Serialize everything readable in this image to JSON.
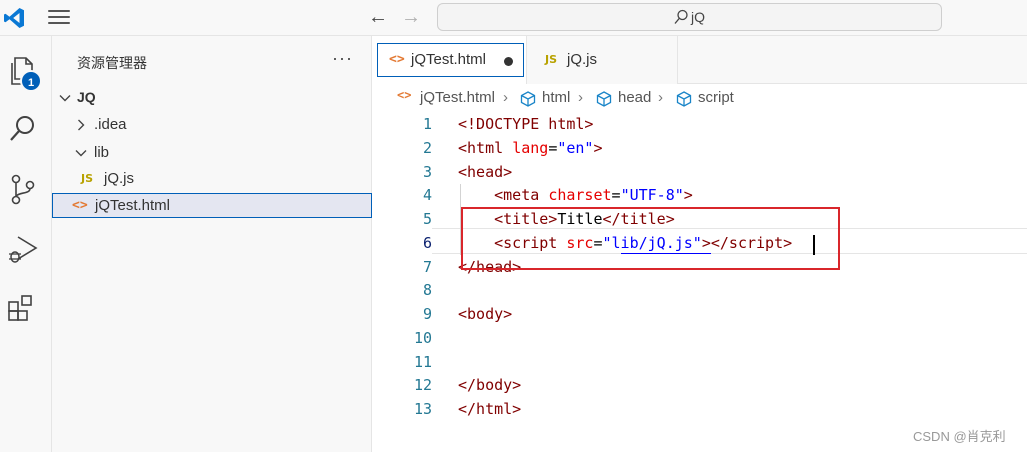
{
  "titlebar": {
    "search_text": "jQ",
    "icons": [
      "vscode-logo",
      "menu-icon",
      "arrow-left-icon",
      "arrow-right-icon",
      "search-icon"
    ]
  },
  "activity_bar": {
    "badge_count": "1",
    "items": [
      "explorer-icon",
      "search-icon",
      "source-control-icon",
      "run-debug-icon",
      "extensions-icon"
    ]
  },
  "explorer": {
    "title": "资源管理器",
    "more": "···",
    "root": "JQ",
    "items": [
      {
        "label": ".idea",
        "kind": "folder",
        "expanded": false
      },
      {
        "label": "lib",
        "kind": "folder",
        "expanded": true
      },
      {
        "label": "jQ.js",
        "kind": "js"
      },
      {
        "label": "jQTest.html",
        "kind": "html",
        "selected": true
      }
    ],
    "js_icon_text": "JS",
    "html_icon_text": "<>"
  },
  "tabs": [
    {
      "label": "jQTest.html",
      "active": true,
      "dirty": true
    },
    {
      "label": "jQ.js",
      "active": false
    }
  ],
  "breadcrumb": [
    "jQTest.html",
    "html",
    "head",
    "script"
  ],
  "editor": {
    "line_numbers": [
      "1",
      "2",
      "3",
      "4",
      "5",
      "6",
      "7",
      "8",
      "9",
      "10",
      "11",
      "12",
      "13"
    ],
    "current_line": 6
  },
  "watermark": "CSDN @肖克利",
  "colors": {
    "accent": "#005fb8",
    "highlight_box": "#d9262b",
    "tag": "#800000",
    "attribute": "#e50000",
    "value": "#0000ff"
  }
}
